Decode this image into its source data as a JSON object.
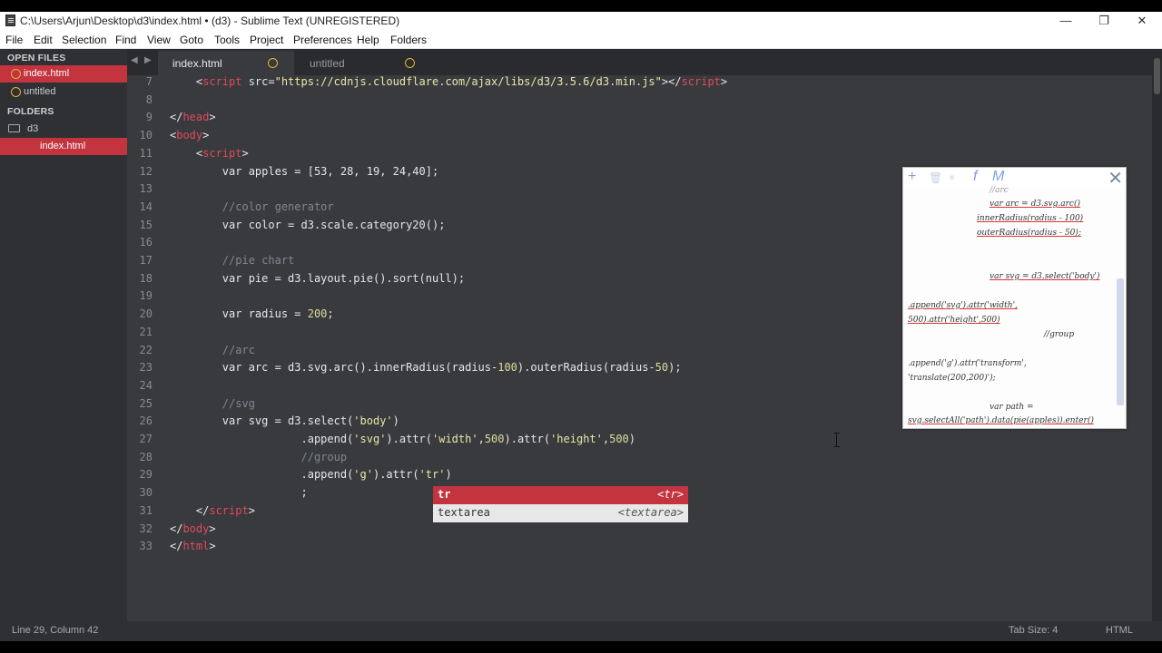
{
  "window": {
    "title": "C:\\Users\\Arjun\\Desktop\\d3\\index.html • (d3) - Sublime Text (UNREGISTERED)",
    "minimize_glyph": "—",
    "restore_glyph": "❐",
    "close_glyph": "✕"
  },
  "menu": [
    "File",
    "Edit",
    "Selection",
    "Find",
    "View",
    "Goto",
    "Tools",
    "Project",
    "Preferences",
    "Help",
    "Folders"
  ],
  "sidebar": {
    "open_files_header": "OPEN FILES",
    "open_files": [
      "index.html",
      "untitled"
    ],
    "folders_header": "FOLDERS",
    "folder": "d3",
    "folder_file": "index.html"
  },
  "tabs": [
    {
      "label": "index.html",
      "active": true
    },
    {
      "label": "untitled",
      "active": false
    }
  ],
  "editor": {
    "lines": [
      {
        "n": "7",
        "tokens": [
          [
            "t-punct",
            "    <"
          ],
          [
            "t-tag",
            "script"
          ],
          [
            "t-punct",
            " src="
          ],
          [
            "t-str",
            "\"https://cdnjs.cloudflare.com/ajax/libs/d3/3.5.6/d3.min.js\""
          ],
          [
            "t-punct",
            "></"
          ],
          [
            "t-tag",
            "script"
          ],
          [
            "t-punct",
            ">"
          ]
        ]
      },
      {
        "n": "8",
        "tokens": []
      },
      {
        "n": "9",
        "tokens": [
          [
            "t-punct",
            "</"
          ],
          [
            "t-tag",
            "head"
          ],
          [
            "t-punct",
            ">"
          ]
        ]
      },
      {
        "n": "10",
        "tokens": [
          [
            "t-punct",
            "<"
          ],
          [
            "t-tag",
            "body"
          ],
          [
            "t-punct",
            ">"
          ]
        ]
      },
      {
        "n": "11",
        "tokens": [
          [
            "t-punct",
            "    <"
          ],
          [
            "t-tag",
            "script"
          ],
          [
            "t-punct",
            ">"
          ]
        ]
      },
      {
        "n": "12",
        "tokens": [
          [
            "t-punct",
            "        var apples = [53, 28, 19, 24,40];"
          ]
        ]
      },
      {
        "n": "13",
        "tokens": []
      },
      {
        "n": "14",
        "tokens": [
          [
            "t-comm",
            "        //color generator"
          ]
        ]
      },
      {
        "n": "15",
        "tokens": [
          [
            "t-punct",
            "        var color = d3.scale.category20();"
          ]
        ]
      },
      {
        "n": "16",
        "tokens": []
      },
      {
        "n": "17",
        "tokens": [
          [
            "t-comm",
            "        //pie chart"
          ]
        ]
      },
      {
        "n": "18",
        "tokens": [
          [
            "t-punct",
            "        var pie = d3.layout.pie().sort(null);"
          ]
        ]
      },
      {
        "n": "19",
        "tokens": []
      },
      {
        "n": "20",
        "tokens": [
          [
            "t-punct",
            "        var radius = "
          ],
          [
            "t-num",
            "200"
          ],
          [
            "t-punct",
            ";"
          ]
        ]
      },
      {
        "n": "21",
        "tokens": []
      },
      {
        "n": "22",
        "tokens": [
          [
            "t-comm",
            "        //arc"
          ]
        ]
      },
      {
        "n": "23",
        "tokens": [
          [
            "t-punct",
            "        var arc = d3.svg.arc().innerRadius(radius-"
          ],
          [
            "t-num",
            "100"
          ],
          [
            "t-punct",
            ").outerRadius(radius-"
          ],
          [
            "t-num",
            "50"
          ],
          [
            "t-punct",
            ");"
          ]
        ]
      },
      {
        "n": "24",
        "tokens": []
      },
      {
        "n": "25",
        "tokens": [
          [
            "t-comm",
            "        //svg"
          ]
        ]
      },
      {
        "n": "26",
        "tokens": [
          [
            "t-punct",
            "        var svg = d3.select("
          ],
          [
            "t-str",
            "'body'"
          ],
          [
            "t-punct",
            ")"
          ]
        ]
      },
      {
        "n": "27",
        "tokens": [
          [
            "t-punct",
            "                    .append("
          ],
          [
            "t-str",
            "'svg'"
          ],
          [
            "t-punct",
            ").attr("
          ],
          [
            "t-str",
            "'width'"
          ],
          [
            "t-punct",
            ","
          ],
          [
            "t-num",
            "500"
          ],
          [
            "t-punct",
            ").attr("
          ],
          [
            "t-str",
            "'height'"
          ],
          [
            "t-punct",
            ","
          ],
          [
            "t-num",
            "500"
          ],
          [
            "t-punct",
            ")"
          ]
        ]
      },
      {
        "n": "28",
        "tokens": [
          [
            "t-comm",
            "                    //group"
          ]
        ]
      },
      {
        "n": "29",
        "tokens": [
          [
            "t-punct",
            "                    .append("
          ],
          [
            "t-str",
            "'g'"
          ],
          [
            "t-punct",
            ").attr("
          ],
          [
            "t-str",
            "'tr'"
          ],
          [
            "t-punct",
            ")"
          ]
        ]
      },
      {
        "n": "30",
        "tokens": [
          [
            "t-punct",
            "                    ;"
          ]
        ]
      },
      {
        "n": "31",
        "tokens": [
          [
            "t-punct",
            "    </"
          ],
          [
            "t-tag",
            "script"
          ],
          [
            "t-punct",
            ">"
          ]
        ]
      },
      {
        "n": "32",
        "tokens": [
          [
            "t-punct",
            "</"
          ],
          [
            "t-tag",
            "body"
          ],
          [
            "t-punct",
            ">"
          ]
        ]
      },
      {
        "n": "33",
        "tokens": [
          [
            "t-punct",
            "</"
          ],
          [
            "t-tag",
            "html"
          ],
          [
            "t-punct",
            ">"
          ]
        ]
      }
    ]
  },
  "autocomplete": [
    {
      "keyword": "tr",
      "hint": "<tr>",
      "selected": true
    },
    {
      "keyword": "textarea",
      "hint": "<textarea>",
      "selected": false
    }
  ],
  "note_widget": {
    "toolbar": [
      "+",
      "🗑",
      "●",
      "f",
      "M"
    ],
    "close": "✕",
    "lines": [
      {
        "text": "//arc",
        "ul": false
      },
      {
        "text": "var arc = d3.svg.arc()",
        "ul": true
      },
      {
        "text": "innerRadius(radius - 100)",
        "ul": true
      },
      {
        "text": "outerRadius(radius - 50);",
        "ul": true
      },
      {
        "text": "var svg = d3.select('body')",
        "ul": true
      },
      {
        "text": ".append('svg').attr('width',",
        "ul": true
      },
      {
        "text": "500).attr('height',500)",
        "ul": true
      },
      {
        "text": "//group",
        "ul": false
      },
      {
        "text": ".append('g').attr('transform',",
        "ul": false
      },
      {
        "text": "'translate(200,200)');",
        "ul": false
      },
      {
        "text": "var path =",
        "ul": false
      },
      {
        "text": "svg.selectAll('path').data(pie(apples)).enter()",
        "ul": true
      }
    ]
  },
  "status": {
    "position": "Line 29, Column 42",
    "tab_size": "Tab Size: 4",
    "syntax": "HTML"
  },
  "colors": {
    "accent": "#c3343f",
    "editor_bg": "#393a3e",
    "sidebar_bg": "#2f3033",
    "tag": "#e04a5a",
    "string": "#e9e7a8"
  }
}
